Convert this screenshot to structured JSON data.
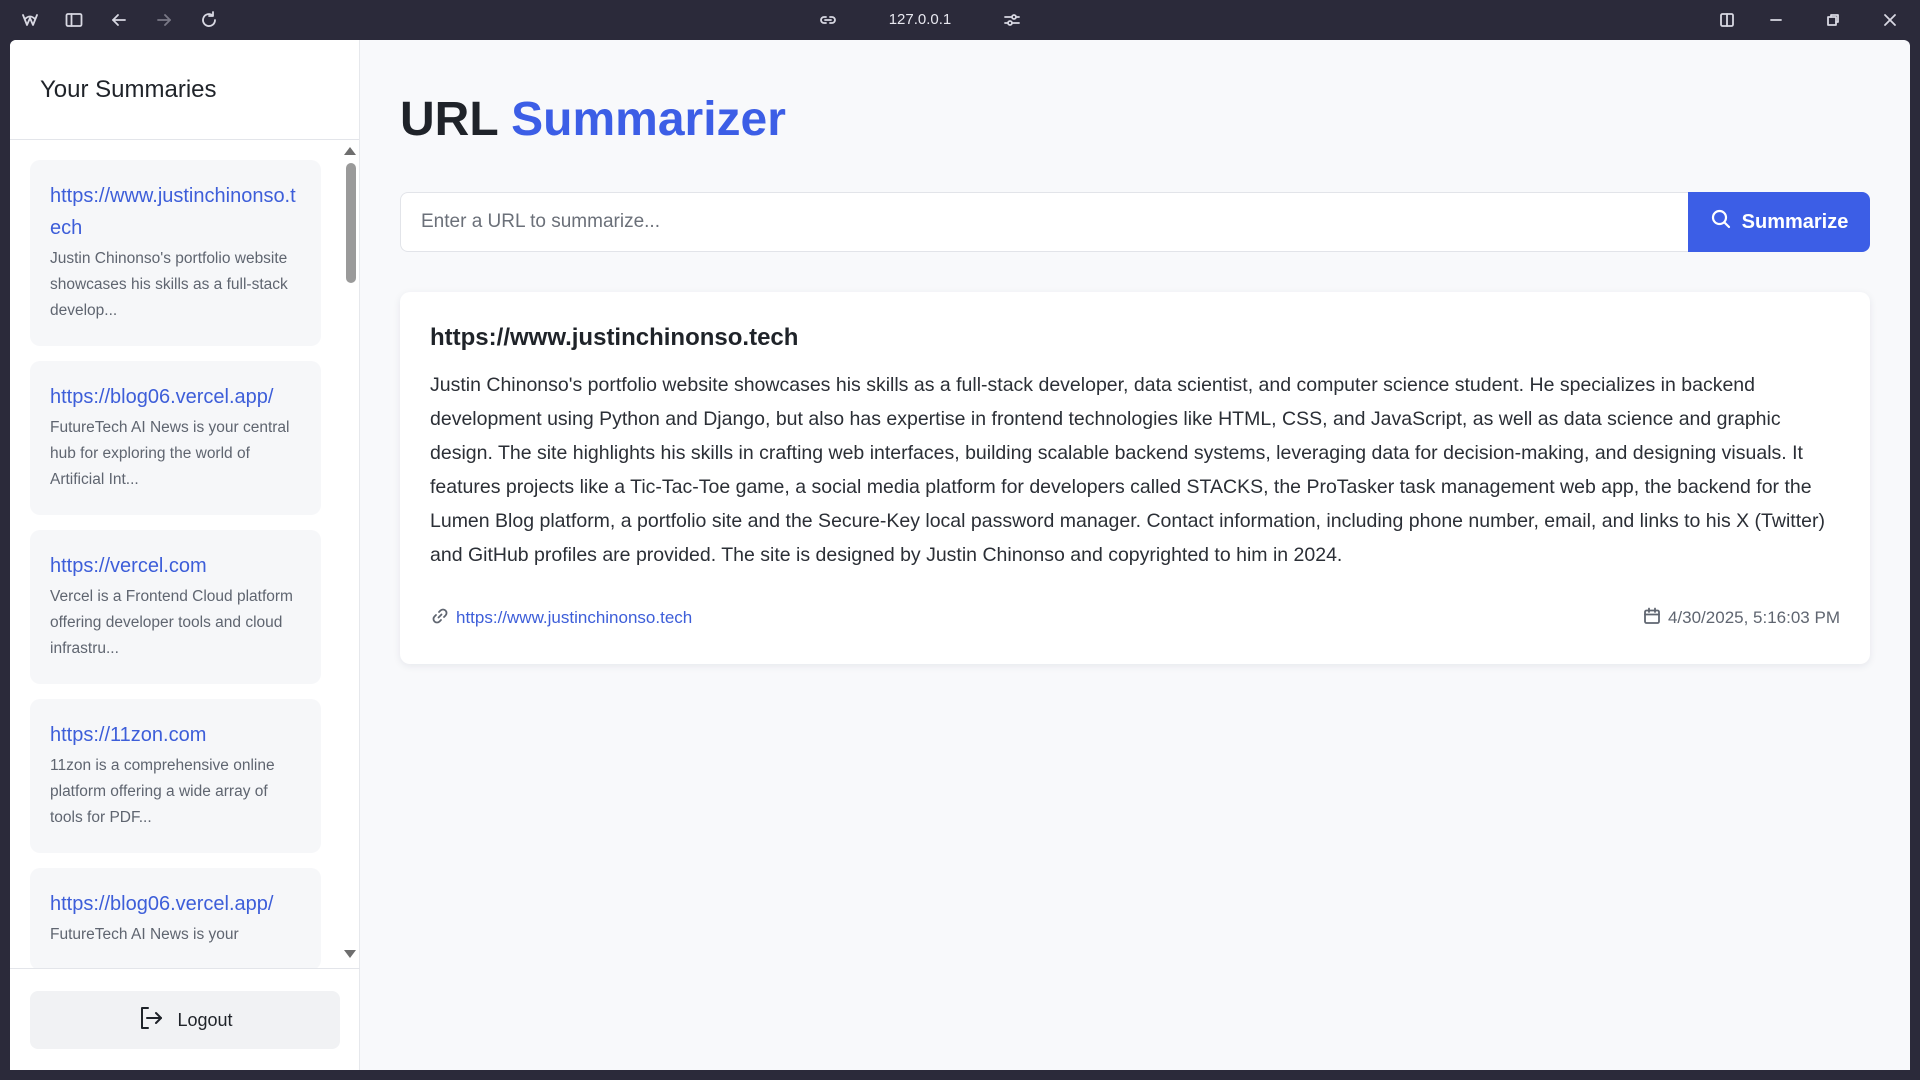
{
  "browser": {
    "address": "127.0.0.1",
    "icons": [
      "browser-logo-icon",
      "sidebar-toggle-icon",
      "back-icon",
      "forward-icon",
      "reload-icon",
      "link-icon",
      "site-settings-icon",
      "split-view-icon",
      "minimize-icon",
      "restore-icon",
      "close-icon"
    ]
  },
  "sidebar": {
    "title": "Your Summaries",
    "items": [
      {
        "url": "https://www.justinchinonso.tech",
        "snippet": "Justin Chinonso's portfolio website showcases his skills as a full-stack develop..."
      },
      {
        "url": "https://blog06.vercel.app/",
        "snippet": "FutureTech AI News is your central hub for exploring the world of Artificial Int..."
      },
      {
        "url": "https://vercel.com",
        "snippet": "Vercel is a Frontend Cloud platform offering developer tools and cloud infrastru..."
      },
      {
        "url": "https://11zon.com",
        "snippet": "11zon is a comprehensive online platform offering a wide array of tools for PDF..."
      },
      {
        "url": "https://blog06.vercel.app/",
        "snippet": "FutureTech AI News is your"
      }
    ],
    "logout_label": "Logout"
  },
  "main": {
    "title_prefix": "URL",
    "title_accent": "Summarizer",
    "input_placeholder": "Enter a URL to summarize...",
    "input_value": "",
    "summarize_label": "Summarize",
    "result": {
      "heading": "https://www.justinchinonso.tech",
      "body": "Justin Chinonso's portfolio website showcases his skills as a full-stack developer, data scientist, and computer science student. He specializes in backend development using Python and Django, but also has expertise in frontend technologies like HTML, CSS, and JavaScript, as well as data science and graphic design. The site highlights his skills in crafting web interfaces, building scalable backend systems, leveraging data for decision-making, and designing visuals. It features projects like a Tic-Tac-Toe game, a social media platform for developers called STACKS, the ProTasker task management web app, the backend for the Lumen Blog platform, a portfolio site and the Secure-Key local password manager. Contact information, including phone number, email, and links to his X (Twitter) and GitHub profiles are provided. The site is designed by Justin Chinonso and copyrighted to him in 2024.",
      "source_link": "https://www.justinchinonso.tech",
      "timestamp": "4/30/2025, 5:16:03 PM"
    }
  },
  "colors": {
    "accent": "#3c5ee6",
    "link": "#3d5ed9",
    "chrome": "#2b2a3a"
  }
}
